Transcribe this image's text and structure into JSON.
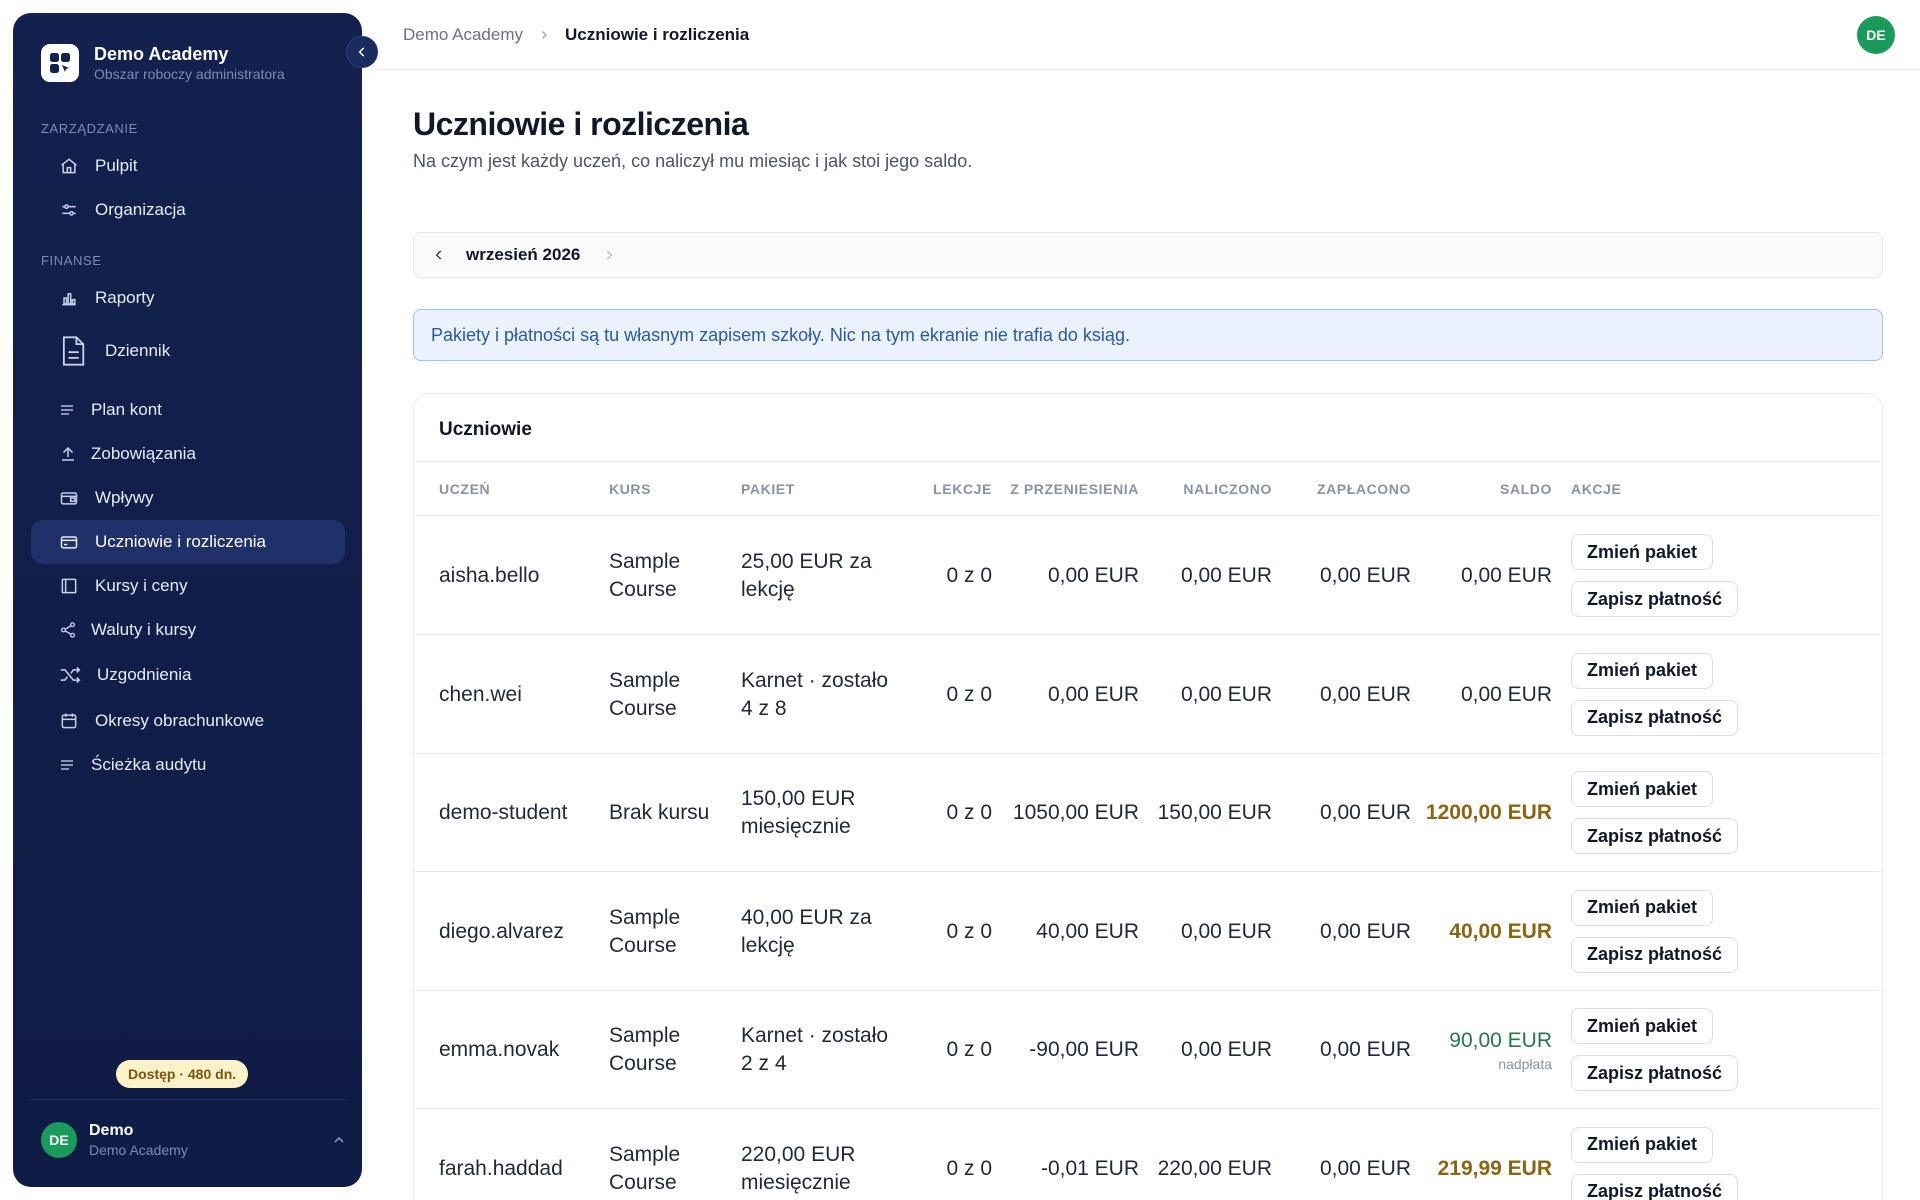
{
  "sidebar": {
    "brand_title": "Demo Academy",
    "brand_subtitle": "Obszar roboczy administratora",
    "sections": {
      "management": "ZARZĄDZANIE",
      "finance": "FINANSE"
    },
    "items": [
      {
        "label": "Pulpit",
        "icon": "home-icon"
      },
      {
        "label": "Organizacja",
        "icon": "sliders-icon"
      },
      {
        "label": "Raporty",
        "icon": "bar-chart-icon"
      },
      {
        "label": "Dziennik",
        "icon": "document-icon"
      },
      {
        "label": "Plan kont",
        "icon": "list-icon"
      },
      {
        "label": "Zobowiązania",
        "icon": "upload-icon"
      },
      {
        "label": "Wpływy",
        "icon": "wallet-icon"
      },
      {
        "label": "Uczniowie i rozliczenia",
        "icon": "card-icon",
        "active": true
      },
      {
        "label": "Kursy i ceny",
        "icon": "book-icon"
      },
      {
        "label": "Waluty i kursy",
        "icon": "share-icon"
      },
      {
        "label": "Uzgodnienia",
        "icon": "shuffle-icon"
      },
      {
        "label": "Okresy obrachunkowe",
        "icon": "calendar-icon"
      },
      {
        "label": "Ścieżka audytu",
        "icon": "list-icon"
      }
    ],
    "access_badge": "Dostęp · 480 dn.",
    "user": {
      "initials": "DE",
      "name": "Demo",
      "org": "Demo Academy"
    }
  },
  "topbar": {
    "breadcrumb_root": "Demo Academy",
    "breadcrumb_current": "Uczniowie i rozliczenia",
    "avatar_initials": "DE"
  },
  "main": {
    "title": "Uczniowie i rozliczenia",
    "subtitle": "Na czym jest każdy uczeń, co naliczył mu miesiąc i jak stoi jego saldo.",
    "month": "wrzesień 2026",
    "info": "Pakiety i płatności są tu własnym zapisem szkoły. Nic na tym ekranie nie trafia do ksiąg.",
    "card_title": "Uczniowie",
    "columns": [
      "UCZEŃ",
      "KURS",
      "PAKIET",
      "LEKCJE",
      "Z PRZENIESIENIA",
      "NALICZONO",
      "ZAPŁACONO",
      "SALDO",
      "AKCJE"
    ],
    "actions": {
      "change": "Zmień pakiet",
      "pay": "Zapisz płatność"
    },
    "rows": [
      {
        "student": "aisha.bello",
        "course": "Sample Course",
        "package": "25,00 EUR za lekcję",
        "lessons": "0 z 0",
        "carried": "0,00 EUR",
        "charged": "0,00 EUR",
        "paid": "0,00 EUR",
        "balance": "0,00 EUR",
        "balance_note": "",
        "status": "neutral"
      },
      {
        "student": "chen.wei",
        "course": "Sample Course",
        "package": "Karnet · zostało 4 z 8",
        "lessons": "0 z 0",
        "carried": "0,00 EUR",
        "charged": "0,00 EUR",
        "paid": "0,00 EUR",
        "balance": "0,00 EUR",
        "balance_note": "",
        "status": "neutral"
      },
      {
        "student": "demo-student",
        "course": "Brak kursu",
        "package": "150,00 EUR miesięcznie",
        "lessons": "0 z 0",
        "carried": "1050,00 EUR",
        "charged": "150,00 EUR",
        "paid": "0,00 EUR",
        "balance": "1200,00 EUR",
        "balance_note": "",
        "status": "warn"
      },
      {
        "student": "diego.alvarez",
        "course": "Sample Course",
        "package": "40,00 EUR za lekcję",
        "lessons": "0 z 0",
        "carried": "40,00 EUR",
        "charged": "0,00 EUR",
        "paid": "0,00 EUR",
        "balance": "40,00 EUR",
        "balance_note": "",
        "status": "warn"
      },
      {
        "student": "emma.novak",
        "course": "Sample Course",
        "package": "Karnet · zostało 2 z 4",
        "lessons": "0 z 0",
        "carried": "-90,00 EUR",
        "charged": "0,00 EUR",
        "paid": "0,00 EUR",
        "balance": "90,00 EUR",
        "balance_note": "nadpłata",
        "status": "good"
      },
      {
        "student": "farah.haddad",
        "course": "Sample Course",
        "package": "220,00 EUR miesięcznie",
        "lessons": "0 z 0",
        "carried": "-0,01 EUR",
        "charged": "220,00 EUR",
        "paid": "0,00 EUR",
        "balance": "219,99 EUR",
        "balance_note": "",
        "status": "warn"
      }
    ]
  },
  "colors": {
    "sidebar_bg": "#13214e",
    "active_item": "#1e3269",
    "avatar": "#1a9b5b",
    "warn": "#8a6512",
    "good": "#23784a",
    "info_bg": "#eaf2fd",
    "info_text": "#2a5aa0"
  }
}
